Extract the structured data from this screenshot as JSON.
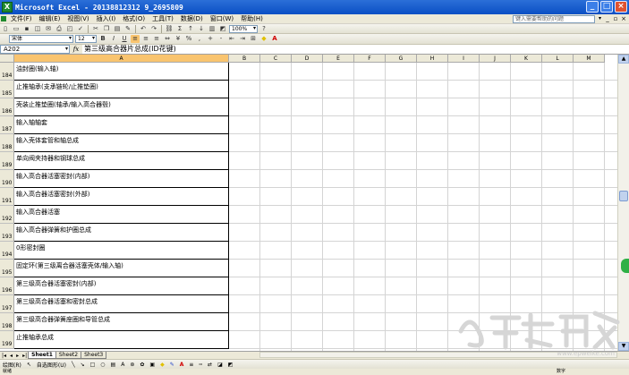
{
  "window": {
    "title": "Microsoft Excel - 20138812312 9_2695809",
    "buttons": [
      "_",
      "□",
      "×"
    ]
  },
  "menu": {
    "items": [
      "文件(F)",
      "编辑(E)",
      "视图(V)",
      "插入(I)",
      "格式(O)",
      "工具(T)",
      "数据(D)",
      "窗口(W)",
      "帮助(H)"
    ],
    "help_placeholder": "键入需要帮助的问题"
  },
  "toolbar": {
    "zoom": "100%",
    "font_name": "宋体",
    "font_size": "12",
    "bold": "B",
    "italic": "I",
    "underline": "U",
    "sum_symbol": "Σ",
    "percent": "%"
  },
  "formula_bar": {
    "name_box": "A202",
    "fx": "fx",
    "content": "第三级高合器片总成(ID花键)"
  },
  "columns": [
    "A",
    "B",
    "C",
    "D",
    "E",
    "F",
    "G",
    "H",
    "I",
    "J",
    "K",
    "L",
    "M"
  ],
  "rows": [
    {
      "num": "184",
      "text": "油封圈(输入轴)"
    },
    {
      "num": "185",
      "text": "止推轴承(支承链轮/止推垫圈)"
    },
    {
      "num": "186",
      "text": "壳装止推垫圈(轴承/输入高合器毂)"
    },
    {
      "num": "187",
      "text": "输入轴轴套"
    },
    {
      "num": "188",
      "text": "输入壳体套管和轴总成"
    },
    {
      "num": "189",
      "text": "单向阀夹持器和钢球总成"
    },
    {
      "num": "190",
      "text": "输入高合器活塞密封(内部)"
    },
    {
      "num": "191",
      "text": "输入高合器活塞密封(外部)"
    },
    {
      "num": "192",
      "text": "输入高合器活塞"
    },
    {
      "num": "193",
      "text": "输入高合器弹簧和护圈总成"
    },
    {
      "num": "194",
      "text": "0形密封圈"
    },
    {
      "num": "195",
      "text": "固定环(第三级离合器活塞壳体/输入轴)"
    },
    {
      "num": "196",
      "text": "第三级高合器活塞密封(内部)"
    },
    {
      "num": "197",
      "text": "第三级高合器活塞和密封总成"
    },
    {
      "num": "198",
      "text": "第三级高合器弹簧座圈和导管总成"
    },
    {
      "num": "199",
      "text": "止推轴承总成"
    }
  ],
  "sheets": [
    "Sheet1",
    "Sheet2",
    "Sheet3"
  ],
  "active_sheet": "Sheet1",
  "drawing_toolbar": {
    "draw_label": "绘图(R)",
    "autoshapes_label": "自选图形(U)"
  },
  "status": {
    "left": "就绪",
    "right": "数字"
  },
  "watermark": {
    "text": "www.epweike.com"
  },
  "colors": {
    "titlebar": "#0a4fc4",
    "header_bg": "#ece9d8",
    "selected_col": "#f9c46f",
    "green_button": "#2fb046"
  }
}
